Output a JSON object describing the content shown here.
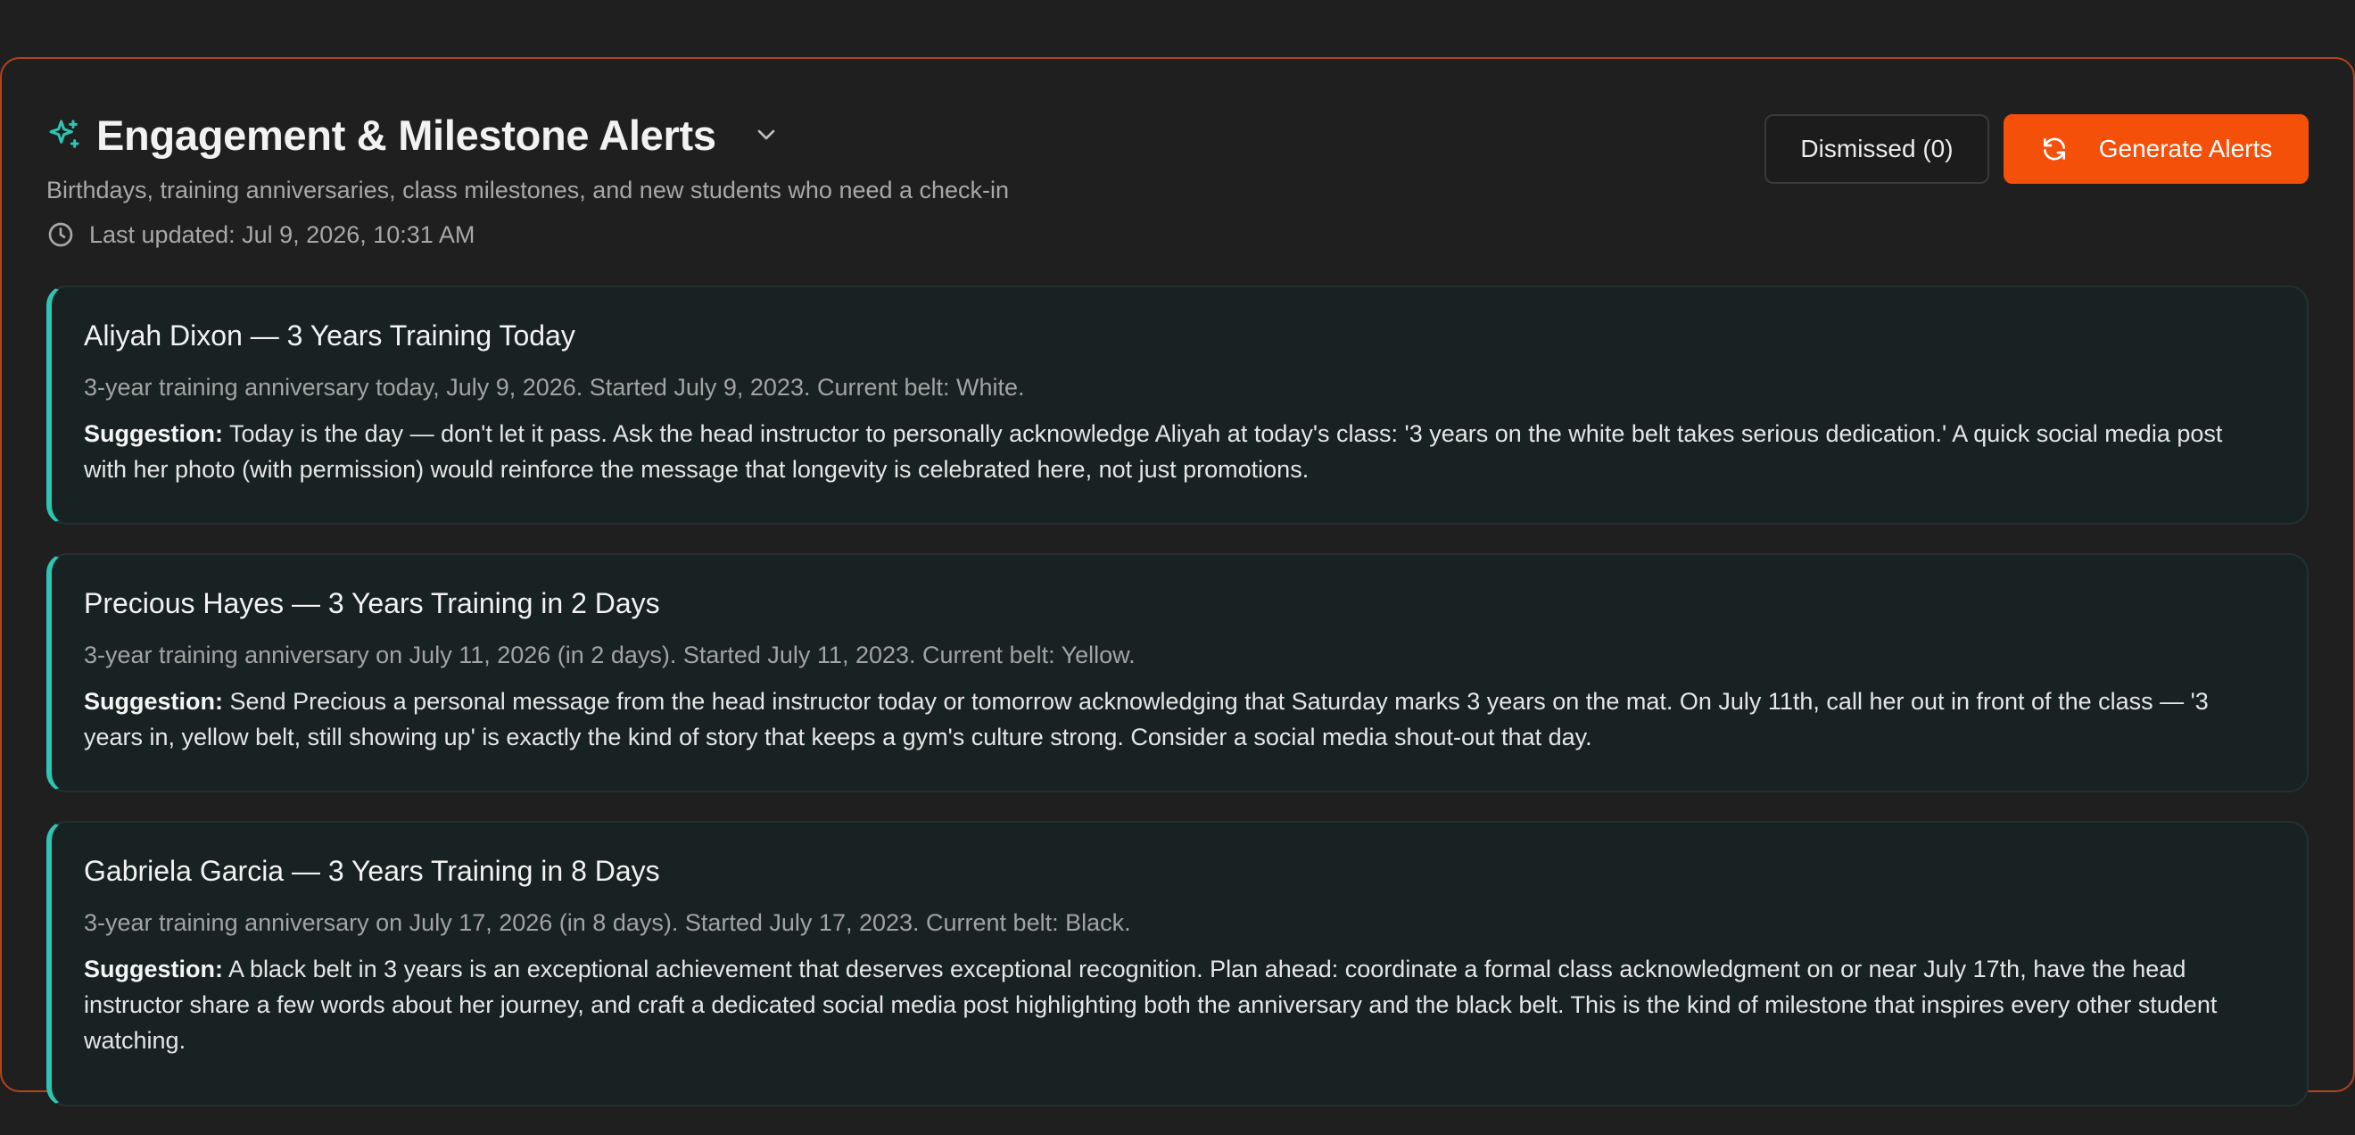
{
  "header": {
    "title": "Engagement & Milestone Alerts",
    "subtitle": "Birthdays, training anniversaries, class milestones, and new students who need a check-in",
    "last_updated": "Last updated: Jul 9, 2026, 10:31 AM"
  },
  "actions": {
    "dismissed_label": "Dismissed (0)",
    "generate_label": "Generate Alerts"
  },
  "colors": {
    "accent": "#f5500a",
    "teal": "#2ec5b2",
    "panel_border": "#b2431b"
  },
  "icons": {
    "title": "sparkle-icon",
    "toggle": "chevron-down-icon",
    "updated": "clock-icon",
    "generate": "refresh-icon"
  },
  "alerts": [
    {
      "title": "Aliyah Dixon — 3 Years Training Today",
      "detail": "3-year training anniversary today, July 9, 2026. Started July 9, 2023. Current belt: White.",
      "suggestion_label": "Suggestion:",
      "suggestion": "Today is the day — don't let it pass. Ask the head instructor to personally acknowledge Aliyah at today's class: '3 years on the white belt takes serious dedication.' A quick social media post with her photo (with permission) would reinforce the message that longevity is celebrated here, not just promotions."
    },
    {
      "title": "Precious Hayes — 3 Years Training in 2 Days",
      "detail": "3-year training anniversary on July 11, 2026 (in 2 days). Started July 11, 2023. Current belt: Yellow.",
      "suggestion_label": "Suggestion:",
      "suggestion": "Send Precious a personal message from the head instructor today or tomorrow acknowledging that Saturday marks 3 years on the mat. On July 11th, call her out in front of the class — '3 years in, yellow belt, still showing up' is exactly the kind of story that keeps a gym's culture strong. Consider a social media shout-out that day."
    },
    {
      "title": "Gabriela Garcia — 3 Years Training in 8 Days",
      "detail": "3-year training anniversary on July 17, 2026 (in 8 days). Started July 17, 2023. Current belt: Black.",
      "suggestion_label": "Suggestion:",
      "suggestion": "A black belt in 3 years is an exceptional achievement that deserves exceptional recognition. Plan ahead: coordinate a formal class acknowledgment on or near July 17th, have the head instructor share a few words about her journey, and craft a dedicated social media post highlighting both the anniversary and the black belt. This is the kind of milestone that inspires every other student watching."
    }
  ]
}
